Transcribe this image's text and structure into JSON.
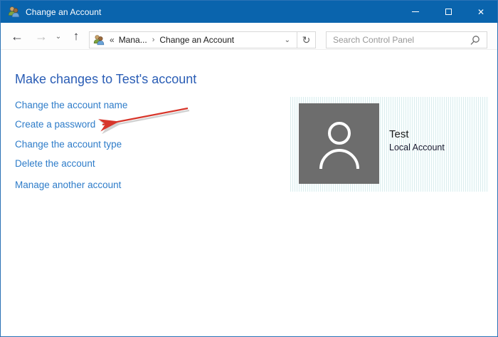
{
  "window": {
    "title": "Change an Account"
  },
  "icons": {
    "back": "←",
    "forward": "→",
    "history_chevron": "⌄",
    "up": "↑",
    "address_chevron": "⌄",
    "refresh": "↻",
    "close": "✕"
  },
  "toolbar": {
    "breadcrumb": {
      "overflow_guillemet": "«",
      "parent": "Mana...",
      "separator": "›",
      "current": "Change an Account"
    },
    "search": {
      "placeholder": "Search Control Panel"
    }
  },
  "main": {
    "heading": "Make changes to Test's account",
    "links": [
      "Change the account name",
      "Create a password",
      "Change the account type",
      "Delete the account"
    ],
    "manage_link": "Manage another account",
    "user_tile": {
      "name": "Test",
      "type": "Local Account"
    }
  },
  "colors": {
    "titlebar": "#0a64ad",
    "window_border": "#2a72b5",
    "heading": "#2a5db5",
    "link": "#2e7cc9",
    "annotation_arrow": "#d7352a",
    "avatar_bg": "#6d6d6d",
    "tile_stripe": "#dcedee"
  }
}
